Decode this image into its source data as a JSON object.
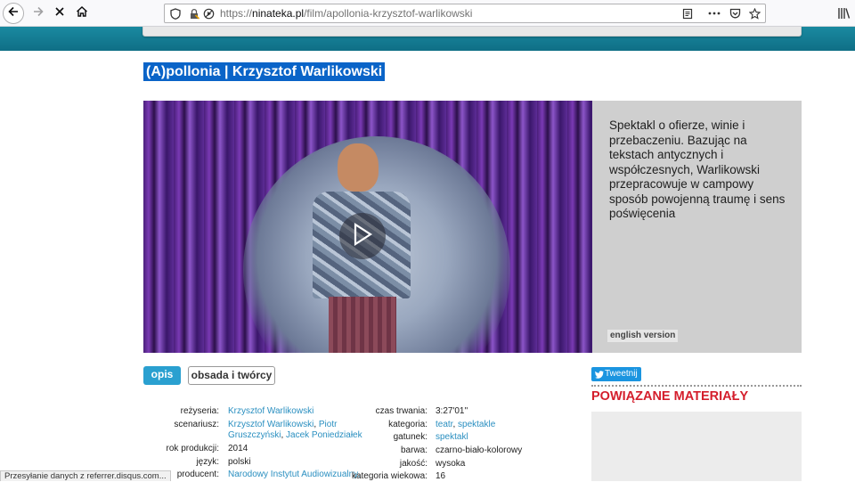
{
  "browser": {
    "url_prefix": "https://",
    "url_host": "ninateka.pl",
    "url_path": "/film/apollonia-krzysztof-warlikowski"
  },
  "page": {
    "title": "(A)pollonia | Krzysztof Warlikowski",
    "description": "Spektakl o ofierze, winie i przebaczeniu. Bazując na tekstach antycznych i współczesnych, Warlikowski przepracowuje w campowy sposób powojenną traumę i sens poświęcenia",
    "english_version": "english version",
    "tabs": {
      "opis": "opis",
      "obsada": "obsada i twórcy"
    },
    "tweet_label": "Tweetnij",
    "related_title": "POWIĄZANE MATERIAŁY"
  },
  "metadata_left": {
    "rezyseria_label": "reżyseria:",
    "rezyseria_value": "Krzysztof Warlikowski",
    "scenariusz_label": "scenariusz:",
    "scenariusz_value_1": "Krzysztof Warlikowski",
    "scenariusz_sep_1": ",",
    "scenariusz_value_2a": "Piotr",
    "scenariusz_value_2b": "Gruszczyński",
    "scenariusz_sep_2": ",",
    "scenariusz_value_3": "Jacek Poniedziałek",
    "rok_label": "rok produkcji:",
    "rok_value": "2014",
    "jezyk_label": "język:",
    "jezyk_value": "polski",
    "producent_label": "producent:",
    "producent_value": "Narodowy Instytut Audiowizualny,"
  },
  "metadata_right": {
    "czas_label": "czas trwania:",
    "czas_value": "3:27'01''",
    "kategoria_label": "kategoria:",
    "kategoria_value_1": "teatr",
    "kategoria_sep": ",",
    "kategoria_value_2": "spektakle",
    "gatunek_label": "gatunek:",
    "gatunek_value": "spektakl",
    "barwa_label": "barwa:",
    "barwa_value": "czarno-biało-kolorowy",
    "jakosc_label": "jakość:",
    "jakosc_value": "wysoka",
    "wiekowa_label": "kategoria wiekowa:",
    "wiekowa_value": "16"
  },
  "status_bar": "Przesyłanie danych z referrer.disqus.com..."
}
